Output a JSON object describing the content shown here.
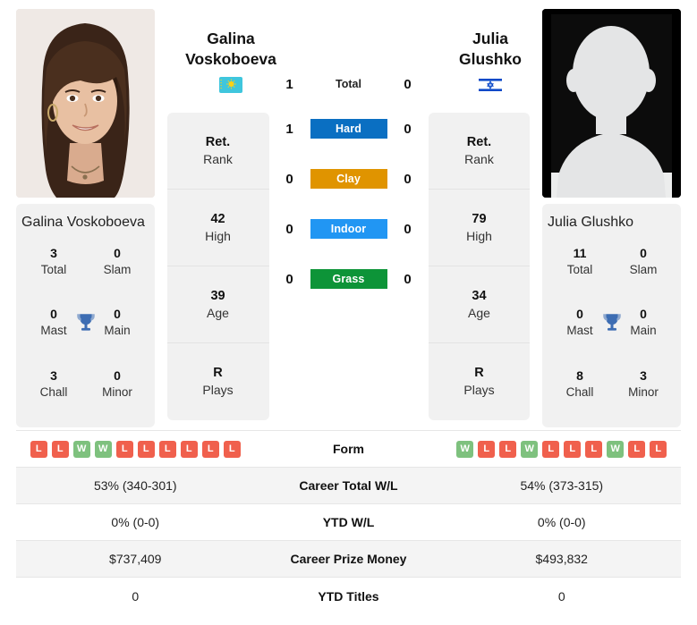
{
  "players": {
    "left": {
      "first_name": "Galina",
      "last_name": "Voskoboeva",
      "full_name": "Galina Voskoboeva",
      "country": "Kazakhstan",
      "flag_icon": "flag-kazakhstan-icon",
      "photo_type": "player-photo",
      "info": [
        {
          "value": "Ret.",
          "label": "Rank"
        },
        {
          "value": "42",
          "label": "High"
        },
        {
          "value": "39",
          "label": "Age"
        },
        {
          "value": "R",
          "label": "Plays"
        }
      ],
      "titles": [
        {
          "value": "3",
          "label": "Total"
        },
        {
          "value": "0",
          "label": "Slam"
        },
        {
          "value": "0",
          "label": "Mast"
        },
        {
          "value": "0",
          "label": "Main"
        },
        {
          "value": "3",
          "label": "Chall"
        },
        {
          "value": "0",
          "label": "Minor"
        }
      ],
      "form": [
        "L",
        "L",
        "W",
        "W",
        "L",
        "L",
        "L",
        "L",
        "L",
        "L"
      ]
    },
    "right": {
      "first_name": "Julia",
      "last_name": "Glushko",
      "full_name": "Julia Glushko",
      "country": "Israel",
      "flag_icon": "flag-israel-icon",
      "photo_type": "player-photo-placeholder",
      "info": [
        {
          "value": "Ret.",
          "label": "Rank"
        },
        {
          "value": "79",
          "label": "High"
        },
        {
          "value": "34",
          "label": "Age"
        },
        {
          "value": "R",
          "label": "Plays"
        }
      ],
      "titles": [
        {
          "value": "11",
          "label": "Total"
        },
        {
          "value": "0",
          "label": "Slam"
        },
        {
          "value": "0",
          "label": "Mast"
        },
        {
          "value": "0",
          "label": "Main"
        },
        {
          "value": "8",
          "label": "Chall"
        },
        {
          "value": "3",
          "label": "Minor"
        }
      ],
      "form": [
        "W",
        "L",
        "L",
        "W",
        "L",
        "L",
        "L",
        "W",
        "L",
        "L"
      ]
    }
  },
  "head_to_head": [
    {
      "label": "Total",
      "left": "1",
      "right": "0",
      "style": "plain",
      "color": ""
    },
    {
      "label": "Hard",
      "left": "1",
      "right": "0",
      "style": "pill",
      "color": "#0a6fc2"
    },
    {
      "label": "Clay",
      "left": "0",
      "right": "0",
      "style": "pill",
      "color": "#e09400"
    },
    {
      "label": "Indoor",
      "left": "0",
      "right": "0",
      "style": "pill",
      "color": "#2196f3"
    },
    {
      "label": "Grass",
      "left": "0",
      "right": "0",
      "style": "pill",
      "color": "#0d9438"
    }
  ],
  "stats_rows": [
    {
      "label": "Form",
      "left": "",
      "right": "",
      "type": "form"
    },
    {
      "label": "Career Total W/L",
      "left": "53% (340-301)",
      "right": "54% (373-315)",
      "type": "text"
    },
    {
      "label": "YTD W/L",
      "left": "0% (0-0)",
      "right": "0% (0-0)",
      "type": "text"
    },
    {
      "label": "Career Prize Money",
      "left": "$737,409",
      "right": "$493,832",
      "type": "text"
    },
    {
      "label": "YTD Titles",
      "left": "0",
      "right": "0",
      "type": "text"
    }
  ],
  "colors": {
    "hard": "#0a6fc2",
    "clay": "#e09400",
    "indoor": "#2196f3",
    "grass": "#0d9438",
    "win": "#7ec17e",
    "loss": "#f0604d",
    "trophy": "#3d6db3",
    "card_bg": "#f1f1f1"
  }
}
